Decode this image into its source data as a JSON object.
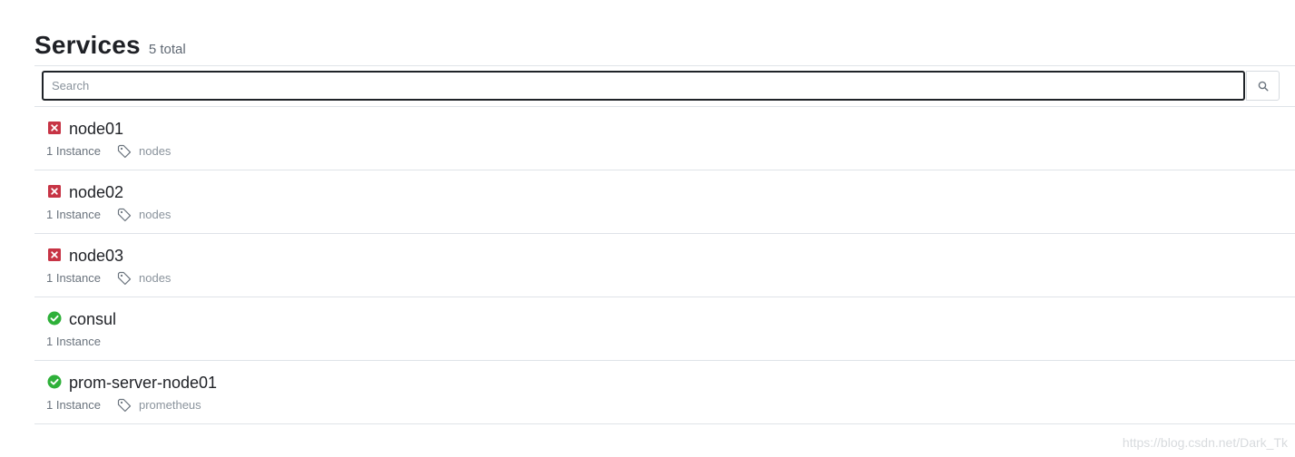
{
  "header": {
    "title": "Services",
    "total": "5 total"
  },
  "search": {
    "placeholder": "Search",
    "value": "",
    "button_icon": "search-icon"
  },
  "services": [
    {
      "name": "node01",
      "status": "critical",
      "status_icon": "x-icon",
      "instances": "1 Instance",
      "tag_icon": "tag-icon",
      "tags": "nodes"
    },
    {
      "name": "node02",
      "status": "critical",
      "status_icon": "x-icon",
      "instances": "1 Instance",
      "tag_icon": "tag-icon",
      "tags": "nodes"
    },
    {
      "name": "node03",
      "status": "critical",
      "status_icon": "x-icon",
      "instances": "1 Instance",
      "tag_icon": "tag-icon",
      "tags": "nodes"
    },
    {
      "name": "consul",
      "status": "passing",
      "status_icon": "check-circle-icon",
      "instances": "1 Instance",
      "tags": ""
    },
    {
      "name": "prom-server-node01",
      "status": "passing",
      "status_icon": "check-circle-icon",
      "instances": "1 Instance",
      "tag_icon": "tag-icon",
      "tags": "prometheus"
    }
  ],
  "colors": {
    "critical": "#c73445",
    "passing": "#2eb039"
  },
  "watermark": "https://blog.csdn.net/Dark_Tk"
}
